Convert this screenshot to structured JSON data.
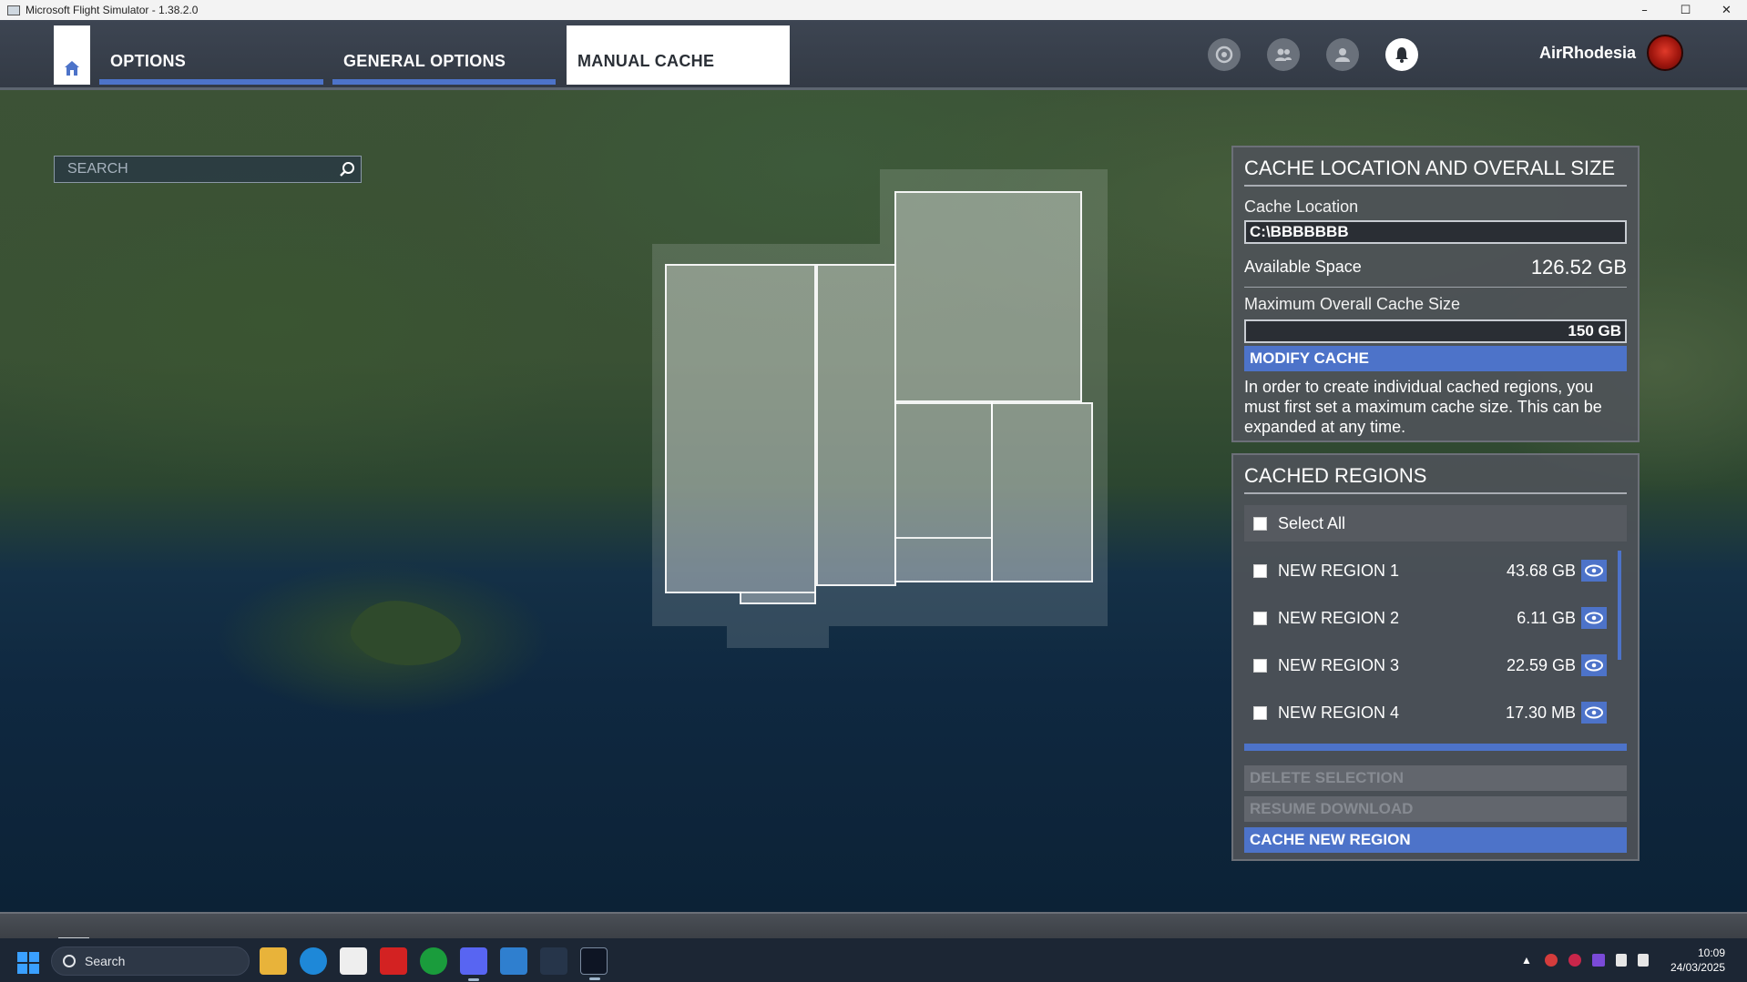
{
  "window": {
    "title": "Microsoft Flight Simulator - 1.38.2.0",
    "controls": {
      "minimize": "–",
      "maximize": "☐",
      "close": "✕"
    }
  },
  "nav": {
    "tabs": [
      {
        "label": "OPTIONS",
        "state": "underlined"
      },
      {
        "label": "GENERAL OPTIONS",
        "state": "underlined"
      },
      {
        "label": "MANUAL CACHE",
        "state": "active"
      }
    ],
    "icons": [
      "activity-icon",
      "friends-icon",
      "profile-icon",
      "notifications-icon"
    ],
    "username": "AirRhodesia"
  },
  "search": {
    "placeholder": "SEARCH",
    "value": ""
  },
  "cache_panel": {
    "title": "CACHE LOCATION AND OVERALL SIZE",
    "location_label": "Cache Location",
    "location_value": "C:\\BBBBBBB",
    "available_label": "Available Space",
    "available_value": "126.52 GB",
    "max_label": "Maximum Overall Cache Size",
    "max_value": "150 GB",
    "modify_button": "MODIFY CACHE",
    "info_text": "In order to create individual cached regions, you must first set a maximum cache size. This can be expanded at any time."
  },
  "regions_panel": {
    "title": "CACHED REGIONS",
    "select_all": "Select All",
    "regions": [
      {
        "name": "NEW REGION 1",
        "size": "43.68 GB"
      },
      {
        "name": "NEW REGION 2",
        "size": "6.11 GB"
      },
      {
        "name": "NEW REGION 3",
        "size": "22.59 GB"
      },
      {
        "name": "NEW REGION 4",
        "size": "17.30 MB"
      }
    ],
    "delete_button": "DELETE SELECTION",
    "resume_button": "RESUME DOWNLOAD",
    "cache_new_button": "CACHE NEW REGION"
  },
  "taskbar": {
    "search_label": "Search",
    "time": "10:09",
    "date": "24/03/2025"
  },
  "colors": {
    "accent": "#4d73c9",
    "panel": "#4e5258",
    "nav_bg": "#363d48"
  }
}
